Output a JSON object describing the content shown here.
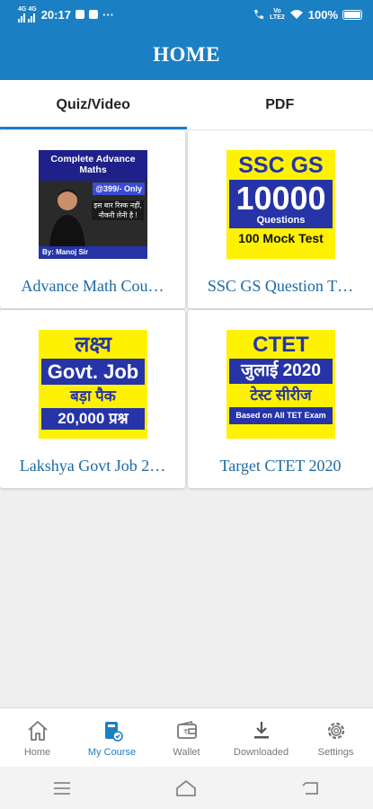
{
  "status_bar": {
    "net_top": "4G",
    "net_bottom": "4G",
    "time": "20:17",
    "extra": "···",
    "volte_top": "Vo",
    "volte_bottom": "LTE2",
    "battery": "100%"
  },
  "app_bar": {
    "title": "HOME"
  },
  "tabs": [
    {
      "label": "Quiz/Video",
      "active": true
    },
    {
      "label": "PDF",
      "active": false
    }
  ],
  "courses": [
    {
      "title": "Advance Math Cou…",
      "thumb": {
        "head": "Complete Advance Maths",
        "price": "@399/- Only",
        "text": "इस बार रिस्क नहीं, नौकरी लेनी है !",
        "by": "By: Manoj Sir"
      }
    },
    {
      "title": "SSC GS Question T…",
      "thumb": {
        "line1": "SSC GS",
        "line2": "10000",
        "line3": "Questions",
        "line4": "100 Mock Test"
      }
    },
    {
      "title": "Lakshya Govt Job 2…",
      "thumb": {
        "line1": "लक्ष्य",
        "line2": "Govt. Job",
        "line3": "बड़ा पैक",
        "line4": "20,000 प्रश्न"
      }
    },
    {
      "title": "Target CTET 2020",
      "thumb": {
        "line1": "CTET",
        "line2": "जुलाई 2020",
        "line3": "टेस्ट सीरीज",
        "line4": "Based on All TET Exam"
      }
    }
  ],
  "bottom_nav": [
    {
      "label": "Home",
      "icon": "home-icon",
      "active": false
    },
    {
      "label": "My Course",
      "icon": "my-course-icon",
      "active": true
    },
    {
      "label": "Wallet",
      "icon": "wallet-icon",
      "active": false
    },
    {
      "label": "Downloaded",
      "icon": "download-icon",
      "active": false
    },
    {
      "label": "Settings",
      "icon": "settings-icon",
      "active": false
    }
  ],
  "colors": {
    "primary": "#1b7fc4",
    "title_blue": "#1c6aa6",
    "thumb_yellow": "#fff200",
    "thumb_blue": "#2634a8"
  }
}
